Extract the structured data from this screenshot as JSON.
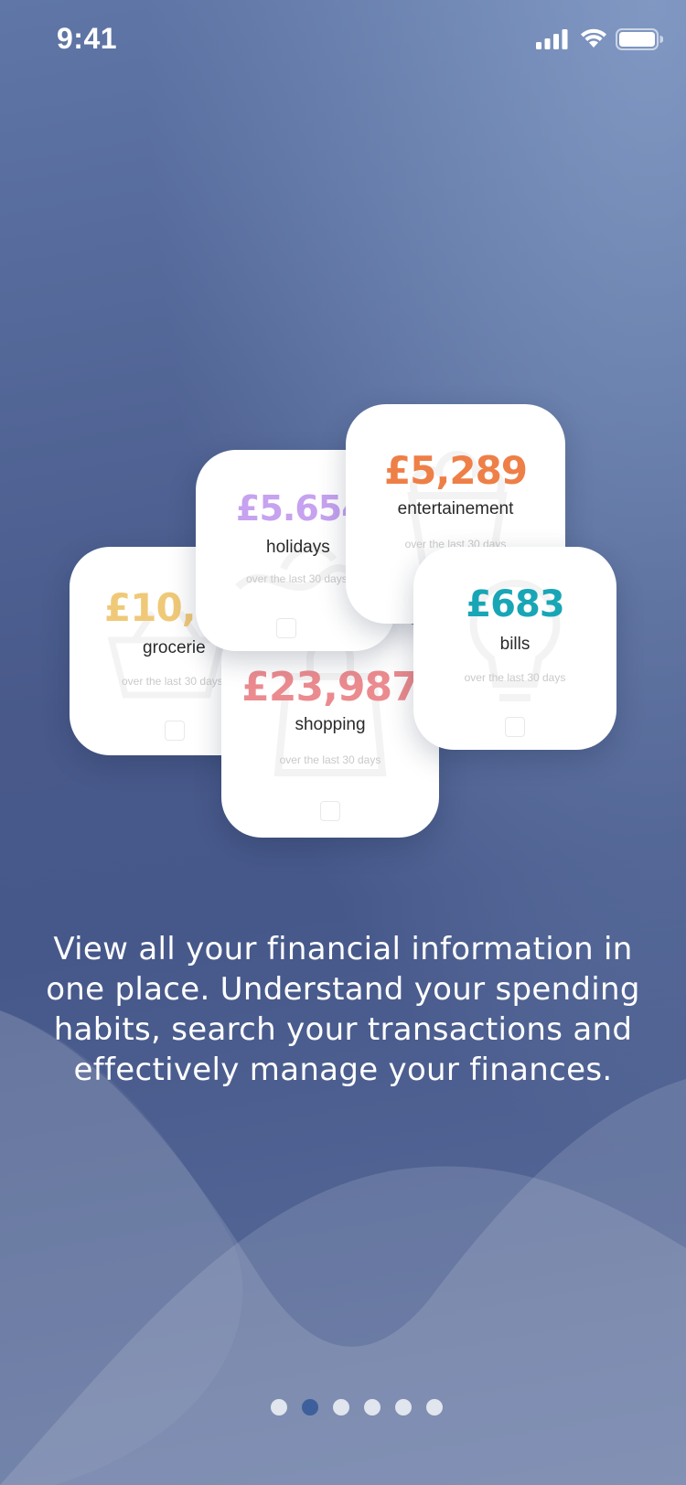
{
  "status_bar": {
    "time": "9:41",
    "icons": [
      "signal-icon",
      "wifi-icon",
      "battery-icon"
    ]
  },
  "cards": {
    "groceries": {
      "amount": "£10,9",
      "label": "grocerie",
      "subtitle": "over the last 30 days",
      "color": "#f0c978",
      "icon": "basket-icon"
    },
    "shopping": {
      "amount": "£23,987",
      "label": "shopping",
      "subtitle": "over the last 30 days",
      "color": "#eb8b8f",
      "icon": "shopping-bag-icon"
    },
    "holidays": {
      "amount": "£5.654",
      "label": "holidays",
      "subtitle": "over the last 30 days",
      "color": "#c6a2f0",
      "icon": "wave-icon"
    },
    "entertainment": {
      "amount": "£5,289",
      "label": "entertainement",
      "subtitle": "over the last 30 days",
      "color": "#ee7f47",
      "icon": "popcorn-icon"
    },
    "bills": {
      "amount": "£683",
      "label": "bills",
      "subtitle": "over the last 30 days",
      "color": "#18a6b6",
      "icon": "lightbulb-icon"
    }
  },
  "description": "View all your financial information in one place. Understand your spending habits, search your transactions and effectively manage your finances.",
  "pagination": {
    "total": 6,
    "current": 2,
    "active_color": "#3d5f9c"
  }
}
